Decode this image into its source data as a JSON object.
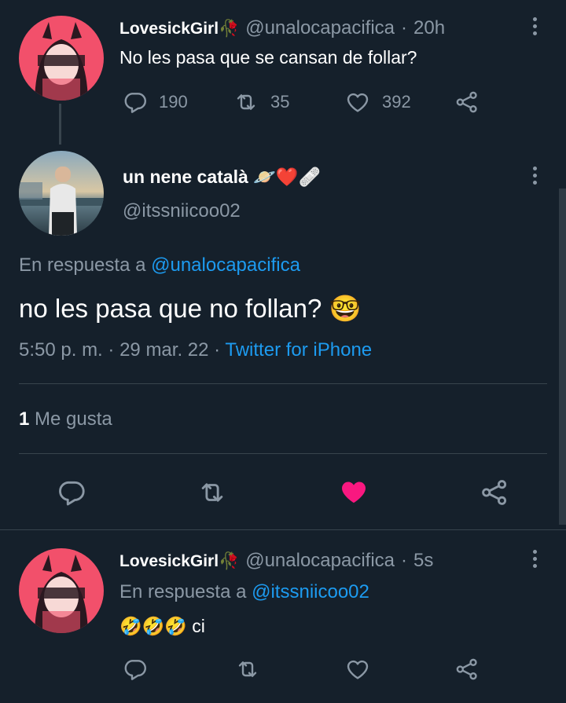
{
  "tweet1": {
    "display_name": "LovesickGirl🥀",
    "handle": "@unalocapacifica",
    "sep": "·",
    "time": "20h",
    "text": "No les pasa que se cansan de follar?",
    "replies": "190",
    "retweets": "35",
    "likes": "392"
  },
  "main": {
    "display_name": "un nene català 🪐❤️🩹",
    "handle": "@itssniicoo02",
    "reply_prefix": "En respuesta a",
    "reply_to": "@unalocapacifica",
    "text": "no les pasa que no follan? 🤓",
    "time": "5:50 p. m.",
    "sep1": "·",
    "date": "29 mar. 22",
    "sep2": "·",
    "source": "Twitter for iPhone",
    "likes_count": "1",
    "likes_label": "Me gusta",
    "liked": true,
    "like_color": "#f91880"
  },
  "reply": {
    "display_name": "LovesickGirl🥀",
    "handle": "@unalocapacifica",
    "sep": "·",
    "time": "5s",
    "reply_prefix": "En respuesta a",
    "reply_to": "@itssniicoo02",
    "text": "🤣🤣🤣 ci"
  },
  "colors": {
    "background": "#15202b",
    "muted": "#8b98a5",
    "accent": "#1d9bf0",
    "like": "#f91880"
  },
  "icons": [
    "reply-icon",
    "retweet-icon",
    "like-icon",
    "share-icon",
    "more-icon"
  ]
}
